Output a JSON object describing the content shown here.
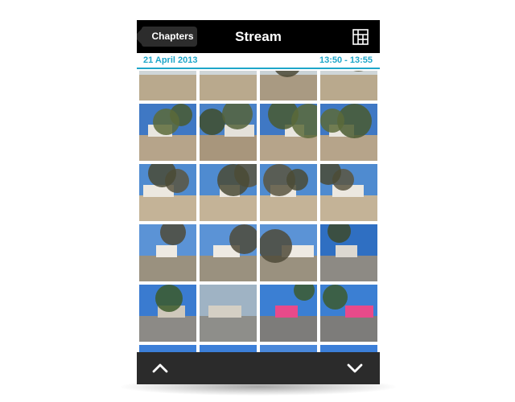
{
  "navbar": {
    "back_label": "Chapters",
    "title": "Stream",
    "grid_icon": "grid-icon"
  },
  "infobar": {
    "date": "21 April 2013",
    "time_range": "13:50 - 13:55",
    "accent_color": "#1ea6c9"
  },
  "photos": {
    "columns": 4,
    "rows": 7,
    "items": [
      {
        "scene": "park-path"
      },
      {
        "scene": "park-path"
      },
      {
        "scene": "park-people"
      },
      {
        "scene": "park-path"
      },
      {
        "scene": "trees-buildings"
      },
      {
        "scene": "trees-people"
      },
      {
        "scene": "trees-buildings"
      },
      {
        "scene": "trees-buildings"
      },
      {
        "scene": "bare-trees"
      },
      {
        "scene": "bare-trees"
      },
      {
        "scene": "bare-trees"
      },
      {
        "scene": "bare-trees"
      },
      {
        "scene": "colonnade"
      },
      {
        "scene": "colonnade"
      },
      {
        "scene": "colonnade"
      },
      {
        "scene": "square"
      },
      {
        "scene": "column-crowd"
      },
      {
        "scene": "stone-building"
      },
      {
        "scene": "ice-cream-van"
      },
      {
        "scene": "ice-cream-van"
      },
      {
        "scene": "blue-sky"
      },
      {
        "scene": "blue-sky"
      },
      {
        "scene": "van-roof"
      },
      {
        "scene": "blue-sky"
      }
    ]
  },
  "toolbar": {
    "up_icon": "chevron-up-icon",
    "down_icon": "chevron-down-icon"
  }
}
